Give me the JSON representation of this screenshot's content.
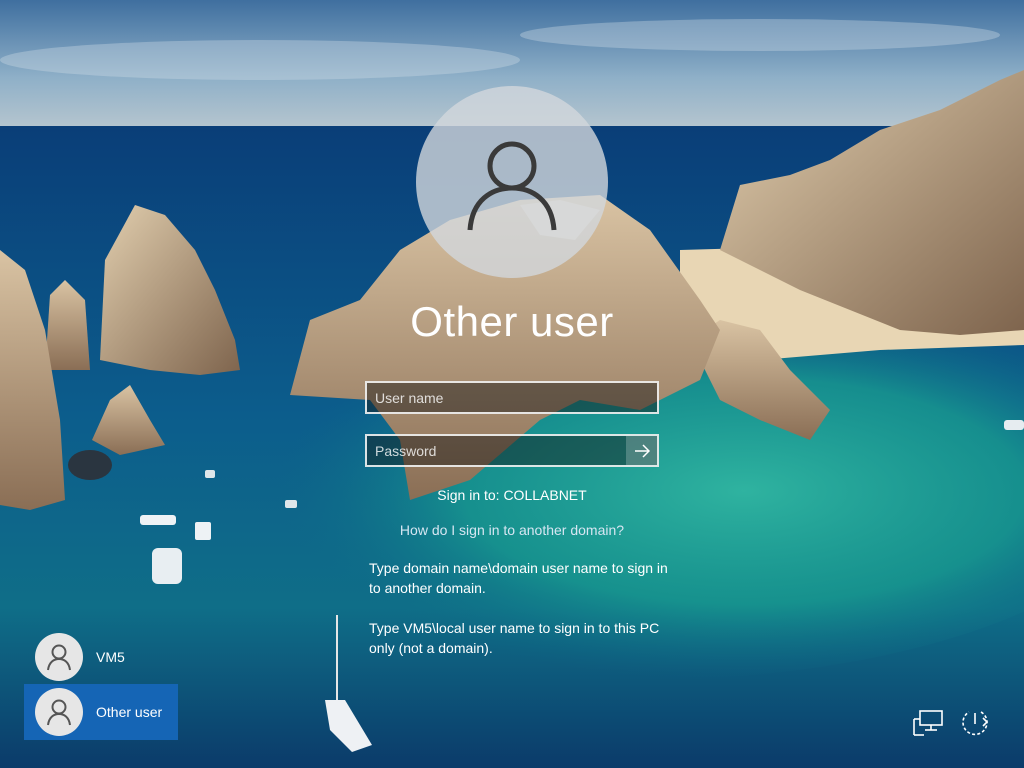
{
  "login": {
    "title": "Other user",
    "username_placeholder": "User name",
    "password_placeholder": "Password",
    "signin_to": "Sign in to: COLLABNET",
    "help_link": "How do I sign in to another domain?",
    "hint_domain": "Type domain name\\domain user name to sign in to another domain.",
    "hint_local": "Type VM5\\local user name to sign in to this PC only (not a domain)."
  },
  "users": [
    {
      "name": "VM5",
      "selected": false
    },
    {
      "name": "Other user",
      "selected": true
    }
  ],
  "icons": {
    "avatar": "person-icon",
    "submit": "arrow-right-icon",
    "network": "network-icon",
    "power": "power-icon"
  },
  "colors": {
    "selected_tile": "#1565b5",
    "avatar_circle": "#d2d7dc"
  }
}
